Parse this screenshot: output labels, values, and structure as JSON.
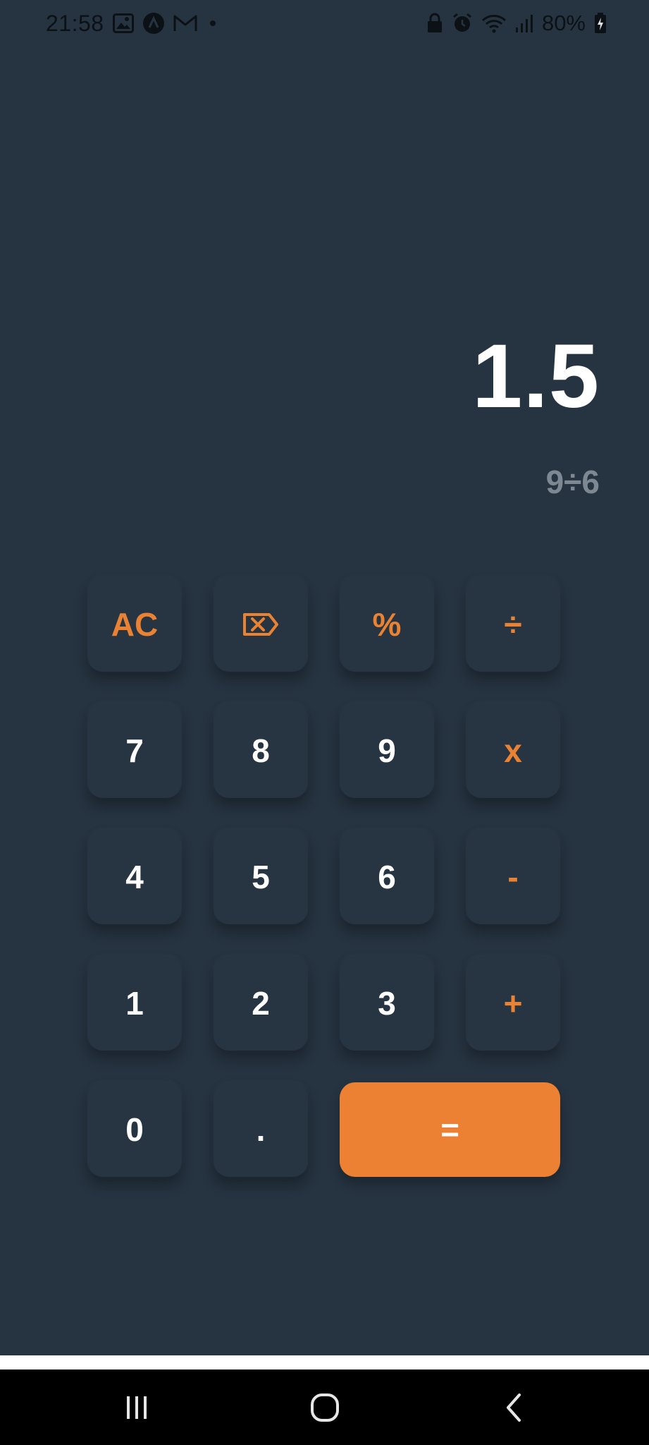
{
  "status_bar": {
    "time": "21:58",
    "battery_percent": "80%",
    "icons_left": [
      "gallery-icon",
      "app-logo-icon",
      "gmail-icon",
      "notification-dot-icon"
    ],
    "icons_right": [
      "lock-icon",
      "alarm-icon",
      "wifi-icon",
      "signal-icon",
      "battery-charging-icon"
    ]
  },
  "display": {
    "result": "1.5",
    "expression": "9÷6"
  },
  "keypad": {
    "rows": [
      [
        {
          "label": "AC",
          "kind": "op"
        },
        {
          "label": "",
          "icon": "backspace-icon",
          "kind": "op"
        },
        {
          "label": "%",
          "kind": "op"
        },
        {
          "label": "÷",
          "kind": "op"
        }
      ],
      [
        {
          "label": "7"
        },
        {
          "label": "8"
        },
        {
          "label": "9"
        },
        {
          "label": "x",
          "kind": "op"
        }
      ],
      [
        {
          "label": "4"
        },
        {
          "label": "5"
        },
        {
          "label": "6"
        },
        {
          "label": "-",
          "kind": "op"
        }
      ],
      [
        {
          "label": "1"
        },
        {
          "label": "2"
        },
        {
          "label": "3"
        },
        {
          "label": "+",
          "kind": "op"
        }
      ],
      [
        {
          "label": "0"
        },
        {
          "label": "."
        },
        {
          "label": "=",
          "kind": "equals"
        }
      ]
    ]
  },
  "nav_bar": {
    "buttons": [
      "recent-apps-icon",
      "home-icon",
      "back-icon"
    ]
  },
  "colors": {
    "background": "#263340",
    "accent": "#EC8133",
    "key_text": "#FFFFFF",
    "expression_text": "#7D8893"
  }
}
